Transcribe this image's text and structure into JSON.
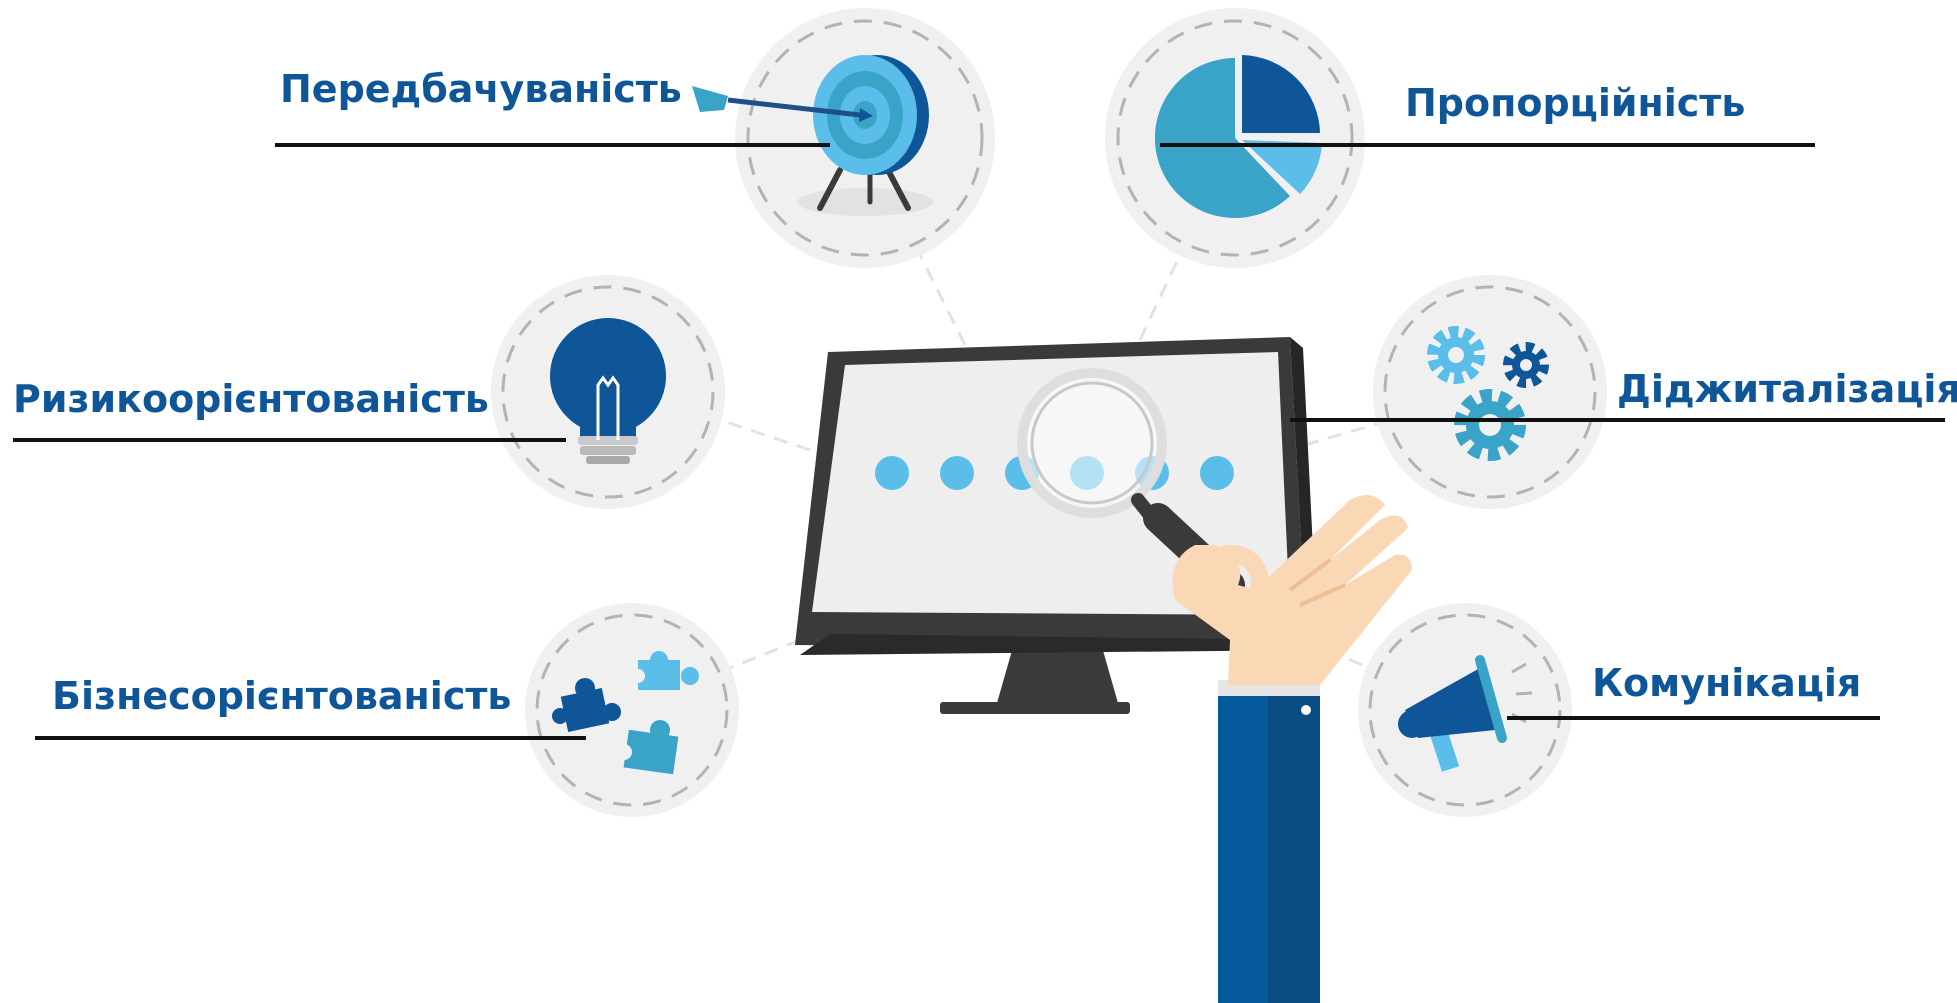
{
  "colors": {
    "label_text": "#0f5699",
    "leader_line": "#111111",
    "circle_fill": "#f0f0f0",
    "circle_dash": "#b3b3b3",
    "dark_blue": "#0f5699",
    "mid_blue": "#3aa3c8",
    "light_blue": "#5bbde9",
    "monitor_frame": "#3a3a3a",
    "monitor_screen": "#eeeeee",
    "skin": "#fbd8b5",
    "sleeve": "#03599a"
  },
  "labels": {
    "predictability": "Передбачуваність",
    "proportionality": "Пропорційність",
    "risk_orientation": "Ризикоорієнтованість",
    "digitalization": "Діджиталізація",
    "business_orientation": "Бізнесорієнтованість",
    "communication": "Комунікація"
  },
  "icons": {
    "predictability": "target-icon",
    "proportionality": "pie-chart-icon",
    "risk_orientation": "lightbulb-icon",
    "digitalization": "gears-icon",
    "business_orientation": "puzzle-icon",
    "communication": "megaphone-icon",
    "center": "monitor-magnifier-icon"
  },
  "screen_dots": 6
}
